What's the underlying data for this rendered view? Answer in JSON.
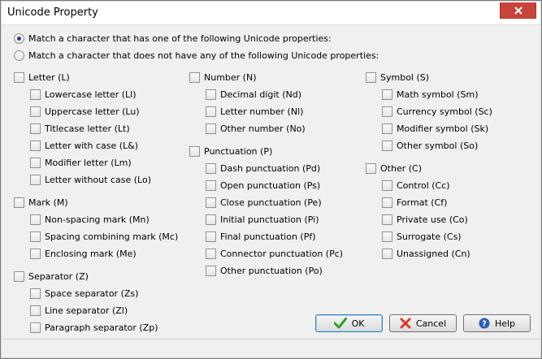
{
  "window": {
    "title": "Unicode Property"
  },
  "mode": {
    "match_has": "Match a character that has one of the following Unicode properties:",
    "match_not": "Match a character that does not have any of the following Unicode properties:"
  },
  "groups": {
    "letter": {
      "label": "Letter (L)",
      "items": [
        "Lowercase letter (Ll)",
        "Uppercase letter (Lu)",
        "Titlecase letter (Lt)",
        "Letter with case (L&)",
        "Modifier letter (Lm)",
        "Letter without case (Lo)"
      ]
    },
    "mark": {
      "label": "Mark (M)",
      "items": [
        "Non-spacing mark (Mn)",
        "Spacing combining mark (Mc)",
        "Enclosing mark (Me)"
      ]
    },
    "separator": {
      "label": "Separator (Z)",
      "items": [
        "Space separator (Zs)",
        "Line separator (Zl)",
        "Paragraph separator (Zp)"
      ]
    },
    "number": {
      "label": "Number (N)",
      "items": [
        "Decimal digit (Nd)",
        "Letter number (Nl)",
        "Other number (No)"
      ]
    },
    "punctuation": {
      "label": "Punctuation (P)",
      "items": [
        "Dash punctuation (Pd)",
        "Open punctuation (Ps)",
        "Close punctuation (Pe)",
        "Initial punctuation (Pi)",
        "Final punctuation (Pf)",
        "Connector punctuation (Pc)",
        "Other punctuation (Po)"
      ]
    },
    "symbol": {
      "label": "Symbol (S)",
      "items": [
        "Math symbol (Sm)",
        "Currency symbol (Sc)",
        "Modifier symbol (Sk)",
        "Other symbol (So)"
      ]
    },
    "other": {
      "label": "Other (C)",
      "items": [
        "Control (Cc)",
        "Format (Cf)",
        "Private use (Co)",
        "Surrogate (Cs)",
        "Unassigned (Cn)"
      ]
    }
  },
  "buttons": {
    "ok": "OK",
    "cancel": "Cancel",
    "help": "Help"
  },
  "colors": {
    "ok_check": "#2e9e2e",
    "cancel_x": "#d93a2b",
    "help_blue": "#2a5fb0",
    "close_red": "#c7443a"
  }
}
